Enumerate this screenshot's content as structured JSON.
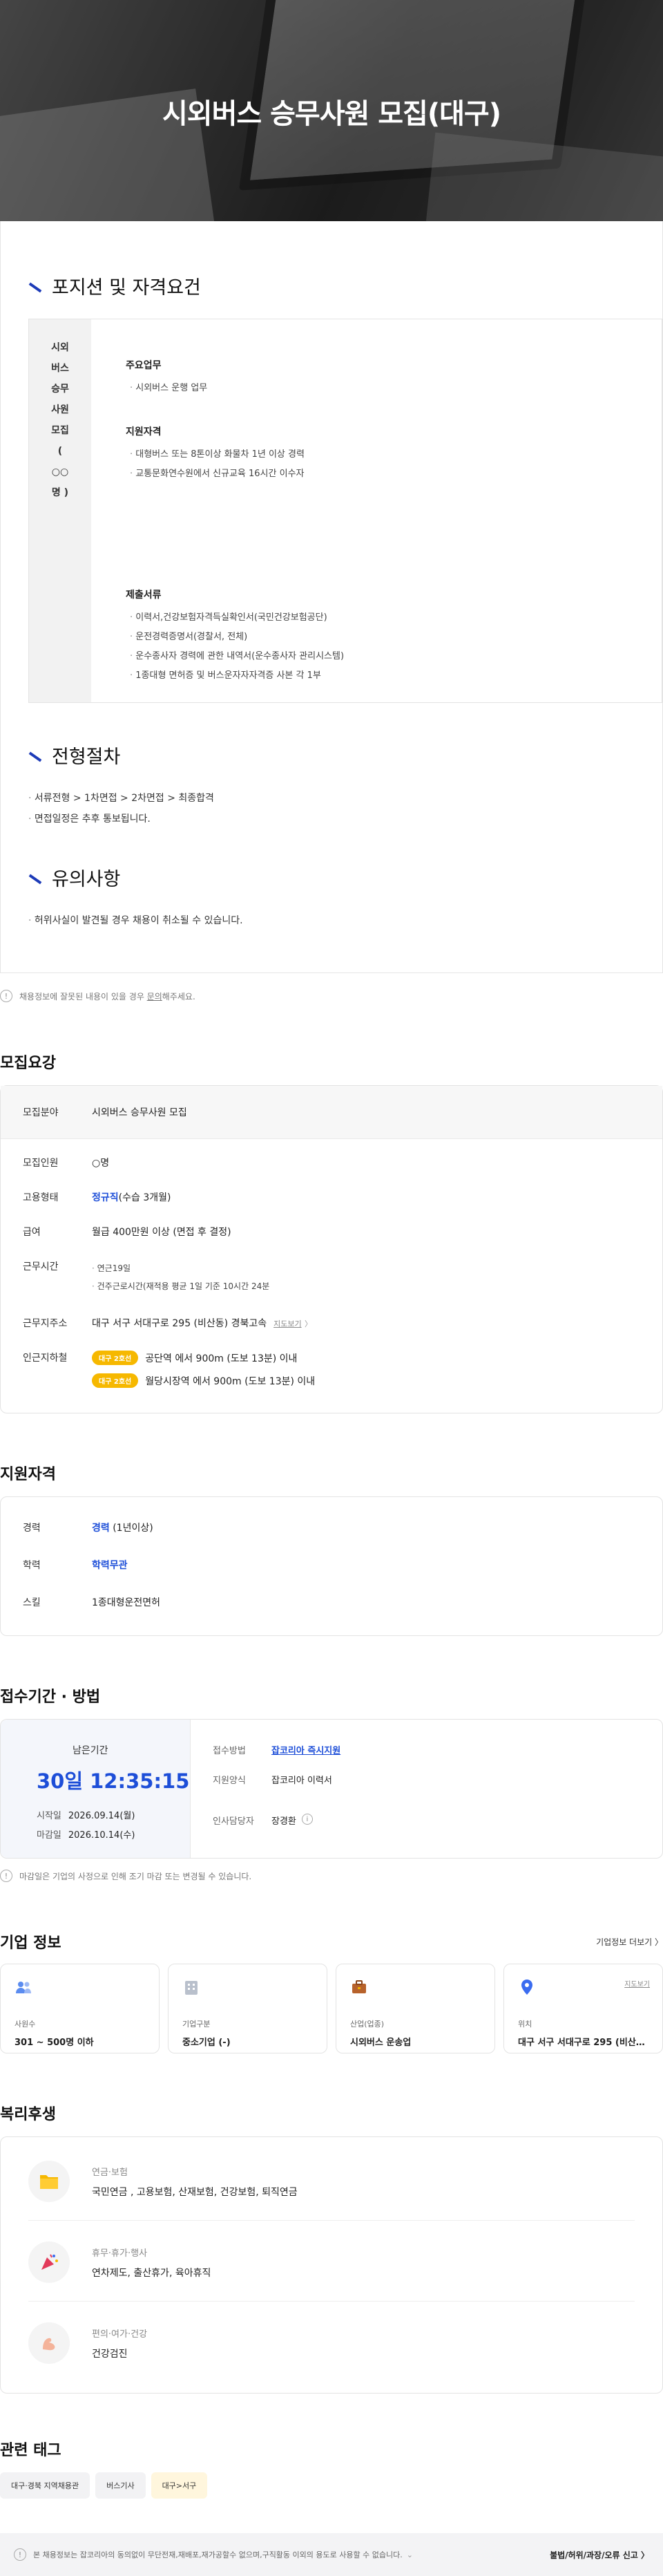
{
  "hero": {
    "title": "시외버스 승무사원 모집(대구)"
  },
  "detail": {
    "position_title": "포지션 및 자격요건",
    "position_name_lines": [
      "시외",
      "버스",
      "승무",
      "사원",
      "모집",
      "(",
      "○○",
      "명 )"
    ],
    "duty": {
      "heading": "주요업무",
      "items": [
        "시외버스 운행 업무"
      ]
    },
    "qualification": {
      "heading": "지원자격",
      "items": [
        "대형버스 또는 8톤이상 화물차 1년 이상 경력",
        "교통문화연수원에서 신규교육 16시간 이수자"
      ]
    },
    "documents": {
      "heading": "제출서류",
      "items": [
        "이력서,건강보험자격득실확인서(국민건강보험공단)",
        "운전경력증명서(경찰서, 전체)",
        "운수종사자 경력에 관한 내역서(운수종사자 관리시스템)",
        "1종대형 면허증 및 버스운자자자격증 사본 각 1부"
      ]
    },
    "process_title": "전형절차",
    "process_items": [
      "서류전형 > 1차면접 > 2차면접 > 최종합격",
      "면접일정은 추후 통보됩니다."
    ],
    "caution_title": "유의사항",
    "caution_items": [
      "허위사실이 발견될 경우 채용이 취소될 수 있습니다."
    ]
  },
  "report": {
    "text": "채용정보에 잘못된 내용이 있을 경우",
    "link": "문의",
    "suffix": "해주세요."
  },
  "summary": {
    "title": "모집요강",
    "field_label": "모집분야",
    "field_value": "시외버스 승무사원 모집",
    "count_label": "모집인원",
    "count_value": "○명",
    "type_label": "고용형태",
    "type_value": "정규직",
    "type_suffix": "(수습 3개월)",
    "salary_label": "급여",
    "salary_value": "월급 400만원 이상 (면접 후 결정)",
    "hours_label": "근무시간",
    "hours_items": [
      "연근19일",
      "건주근로시간(재적용 평균 1일 기준 10시간 24분"
    ],
    "address_label": "근무지주소",
    "address_value": "대구 서구 서대구로 295 (비산동) 경북고속",
    "map_link": "지도보기",
    "subway_label": "인근지하철",
    "subway": [
      {
        "line": "대구 2호선",
        "text": "공단역 에서 900m (도보 13분) 이내"
      },
      {
        "line": "대구 2호선",
        "text": "월당시장역 에서 900m (도보 13분) 이내"
      }
    ]
  },
  "qualification_section": {
    "title": "지원자격",
    "career_label": "경력",
    "career_value": "경력",
    "career_suffix": "(1년이상)",
    "edu_label": "학력",
    "edu_value": "학력무관",
    "skill_label": "스킬",
    "skill_value": "1종대형운전면허"
  },
  "apply": {
    "title": "접수기간 · 방법",
    "remain_label": "남은기간",
    "timer": "30일 12:35:15",
    "start_label": "시작일",
    "start_value": "2026.09.14(월)",
    "end_label": "마감일",
    "end_value": "2026.10.14(수)",
    "method_label": "접수방법",
    "method_value": "잡코리아 즉시지원",
    "form_label": "지원양식",
    "form_value": "잡코리아 이력서",
    "hr_label": "인사담당자",
    "hr_value": "장경환",
    "note": "마감일은 기업의 사정으로 인해 조기 마감 또는 변경될 수 있습니다."
  },
  "corp": {
    "title": "기업 정보",
    "more": "기업정보 더보기 〉",
    "cards": [
      {
        "label": "사원수",
        "value": "301 ~ 500명 이하",
        "icon": "people-icon"
      },
      {
        "label": "기업구분",
        "value": "중소기업 (-)",
        "icon": "building-icon"
      },
      {
        "label": "산업(업종)",
        "value": "시외버스 운송업",
        "icon": "briefcase-icon"
      },
      {
        "label": "위치",
        "value": "대구 서구 서대구로 295 (비산동...",
        "icon": "map-pin-icon",
        "map": "지도보기"
      }
    ]
  },
  "welfare": {
    "title": "복리후생",
    "items": [
      {
        "category": "연금·보험",
        "value": "국민연금 , 고용보험, 산재보험, 건강보험, 퇴직연금"
      },
      {
        "category": "휴무·휴가·행사",
        "value": "연차제도, 출산휴가, 육아휴직"
      },
      {
        "category": "편의·여가·건강",
        "value": "건강검진"
      }
    ]
  },
  "tags": {
    "title": "관련 태그",
    "items": [
      "대구·경북 지역채용관",
      "버스기사",
      "대구>서구"
    ]
  },
  "footer": {
    "text": "본 채용정보는 잡코리아의 동의없이 무단전재,재배포,재가공할수 없으며,구직활동 이외의 용도로 사용할 수 없습니다.",
    "report": "불법/허위/과장/오류 신고 〉"
  },
  "colors": {
    "accent_blue": "#1d4ed8",
    "pill_yellow": "#f6b800"
  }
}
